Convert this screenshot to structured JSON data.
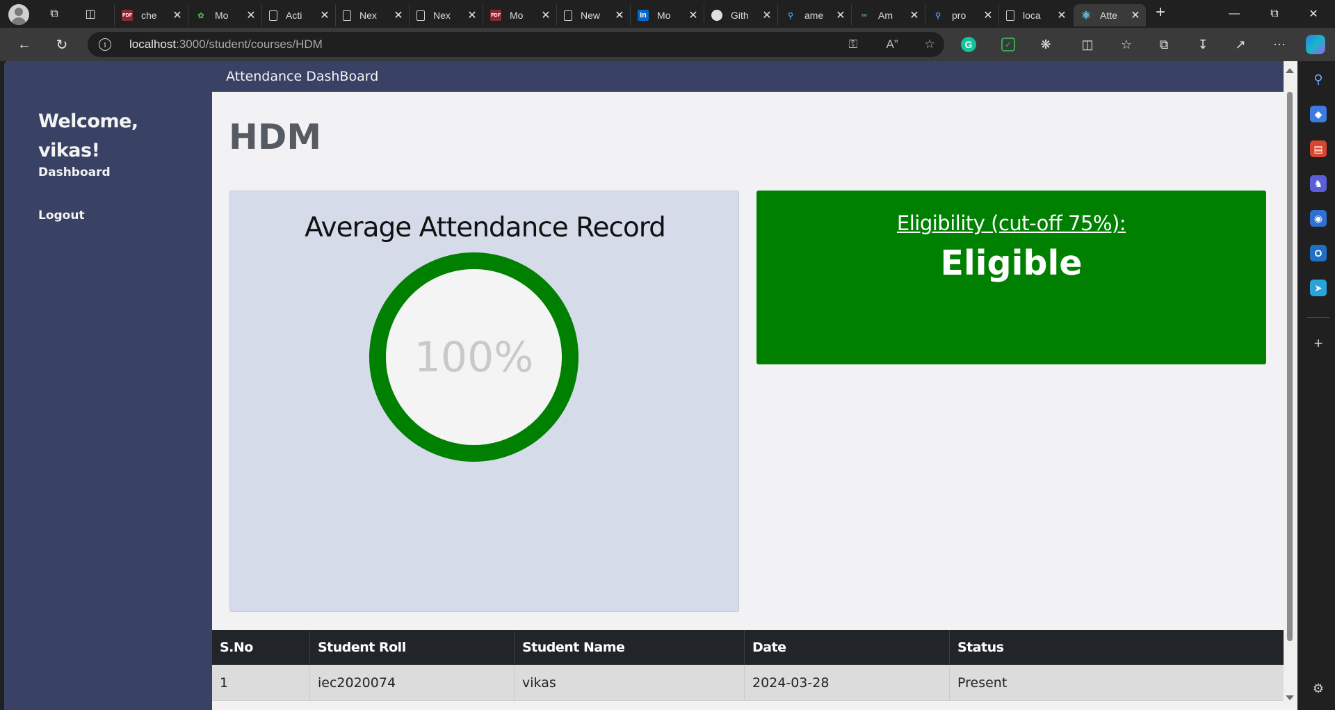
{
  "browser": {
    "tabs": [
      {
        "title": "che",
        "icon": "pdf-icon",
        "active": false
      },
      {
        "title": "Mo",
        "icon": "mongodb-icon",
        "active": false
      },
      {
        "title": "Acti",
        "icon": "document-icon",
        "active": false
      },
      {
        "title": "Nex",
        "icon": "document-icon",
        "active": false
      },
      {
        "title": "Nex",
        "icon": "document-icon",
        "active": false
      },
      {
        "title": "Mo",
        "icon": "pdf-icon",
        "active": false
      },
      {
        "title": "New",
        "icon": "newtab-icon",
        "active": false
      },
      {
        "title": "Mo",
        "icon": "linkedin-icon",
        "active": false
      },
      {
        "title": "Gith",
        "icon": "github-icon",
        "active": false
      },
      {
        "title": "ame",
        "icon": "search-icon",
        "active": false
      },
      {
        "title": "Am",
        "icon": "link-icon",
        "active": false
      },
      {
        "title": "pro",
        "icon": "search-icon",
        "active": false
      },
      {
        "title": "loca",
        "icon": "document-icon",
        "active": false
      },
      {
        "title": "Atte",
        "icon": "react-icon",
        "active": true
      }
    ],
    "url_host": "localhost",
    "url_path": ":3000/student/courses/HDM"
  },
  "app": {
    "topbar_title": "Attendance DashBoard",
    "welcome_line1": "Welcome,",
    "welcome_line2": "vikas!",
    "nav": {
      "dashboard": "Dashboard",
      "logout": "Logout"
    },
    "course_code": "HDM",
    "attendance": {
      "heading": "Average Attendance Record",
      "percent_label": "100%",
      "percent_value": 100,
      "ring_color": "#008000"
    },
    "eligibility": {
      "label": "Eligibility (cut-off 75%):",
      "status": "Eligible",
      "color": "#008000"
    },
    "table": {
      "headers": [
        "S.No",
        "Student Roll",
        "Student Name",
        "Date",
        "Status"
      ],
      "rows": [
        [
          "1",
          "iec2020074",
          "vikas",
          "2024-03-28",
          "Present"
        ]
      ]
    }
  },
  "colors": {
    "sidebar": "#394265",
    "page_bg": "#f2f2f4",
    "card_bg": "#d6dbe9",
    "table_header": "#212529"
  }
}
